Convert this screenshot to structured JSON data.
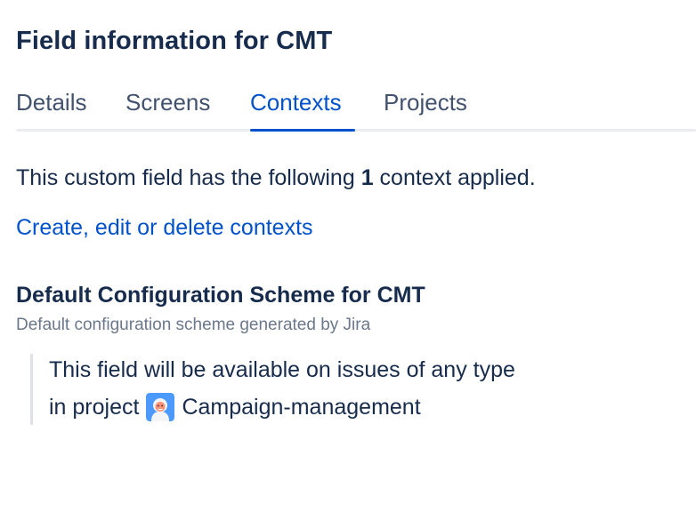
{
  "page": {
    "title": "Field information for CMT"
  },
  "tabs": [
    {
      "label": "Details",
      "active": false
    },
    {
      "label": "Screens",
      "active": false
    },
    {
      "label": "Contexts",
      "active": true
    },
    {
      "label": "Projects",
      "active": false
    }
  ],
  "summary": {
    "prefix": "This custom field has the following ",
    "count": "1",
    "suffix": " context applied."
  },
  "contexts_link": "Create, edit or delete contexts",
  "scheme": {
    "title": "Default Configuration Scheme for CMT",
    "description": "Default configuration scheme generated by Jira",
    "line1": "This field will be available on issues of any type",
    "line2_prefix": "in project",
    "project_icon": "project-avatar-icon",
    "project_name": "Campaign-management"
  },
  "colors": {
    "text": "#172b4d",
    "tab_inactive": "#42526e",
    "accent": "#0052cc",
    "muted": "#6b778c",
    "divider": "#ebecf0",
    "avatar_bg": "#4c9aff"
  }
}
